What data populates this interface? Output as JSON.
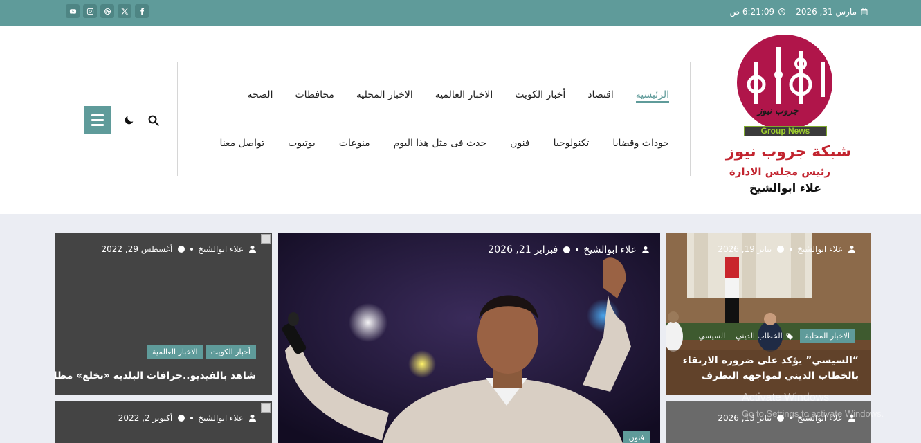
{
  "topbar": {
    "date": "مارس 31, 2026",
    "time": "6:21:09 ص",
    "socials": [
      "youtube-icon",
      "instagram-icon",
      "dribbble-icon",
      "x-icon",
      "facebook-icon"
    ]
  },
  "logo": {
    "arabic_mark": "جروب نيوز",
    "english_mark": "Group News",
    "title": "شبكة جروب نيوز",
    "subtitle": "رئيس مجلس الادارة",
    "name": "علاء ابوالشيخ"
  },
  "nav": {
    "row1": [
      "الرئيسية",
      "اقتصاد",
      "أخبار الكويت",
      "الاخبار العالمية",
      "الاخبار المحلية",
      "محافظات",
      "الصحة"
    ],
    "row2": [
      "حوداث وقضايا",
      "تكنولوجيا",
      "فنون",
      "حدث فى مثل هذا اليوم",
      "منوعات",
      "يوتيوب",
      "تواصل معنا"
    ]
  },
  "cards": {
    "left_top": {
      "author": "علاء ابوالشيخ",
      "date": "أغسطس 29, 2022",
      "tags": [
        "أخبار الكويت",
        "الاخبار العالمية"
      ],
      "headline": "شاهد بالفيديو..جرافات البلدية «تخلع» مظلات السيارات"
    },
    "center": {
      "author": "علاء ابوالشيخ",
      "date": "فبراير 21, 2026",
      "tag": "فنون"
    },
    "right_top": {
      "author": "علاء ابوالشيخ",
      "date": "يناير 19, 2026",
      "tags": [
        "الاخبار المحلية",
        "الخطاب الديني",
        "السيسي"
      ],
      "headline_line1": "“السيسي” يؤكد على ضرورة الارتقاء",
      "headline_line2": "بالخطاب الديني لمواجهة التطرف"
    },
    "left_bottom": {
      "author": "علاء ابوالشيخ",
      "date": "أكتوبر 2, 2022"
    },
    "right_bottom": {
      "author": "علاء ابوالشيخ",
      "date": "يناير 13, 2026"
    }
  },
  "watermark": {
    "line1": "Activate Windows",
    "line2": "Go to Settings to activate Windows."
  },
  "colors": {
    "accent": "#5f9b9a",
    "logo_red": "#b0154a",
    "headline_red": "#c2242f"
  }
}
